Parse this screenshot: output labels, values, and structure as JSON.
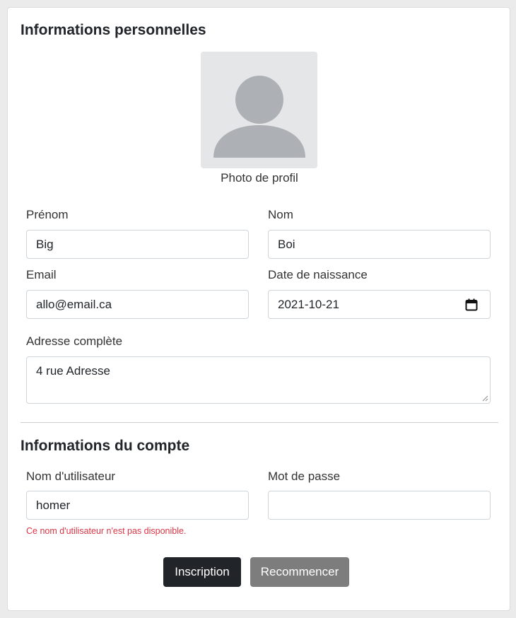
{
  "personal": {
    "title": "Informations personnelles",
    "photo_caption": "Photo de profil",
    "first_name": {
      "label": "Prénom",
      "value": "Big"
    },
    "last_name": {
      "label": "Nom",
      "value": "Boi"
    },
    "email": {
      "label": "Email",
      "value": "allo@email.ca"
    },
    "birth_date": {
      "label": "Date de naissance",
      "value": "2021-10-21",
      "icon": "calendar-icon"
    },
    "address": {
      "label": "Adresse complète",
      "value": "4 rue Adresse"
    }
  },
  "account": {
    "title": "Informations du compte",
    "username": {
      "label": "Nom d'utilisateur",
      "value": "homer",
      "error": "Ce nom d'utilisateur n'est pas disponible."
    },
    "password": {
      "label": "Mot de passe",
      "value": ""
    }
  },
  "actions": {
    "submit_label": "Inscription",
    "reset_label": "Recommencer"
  },
  "colors": {
    "primary_button": "#212529",
    "secondary_button": "#7d7d7d",
    "error": "#dc3545",
    "avatar_bg": "#e5e6e8",
    "avatar_fg": "#adb1b5"
  }
}
